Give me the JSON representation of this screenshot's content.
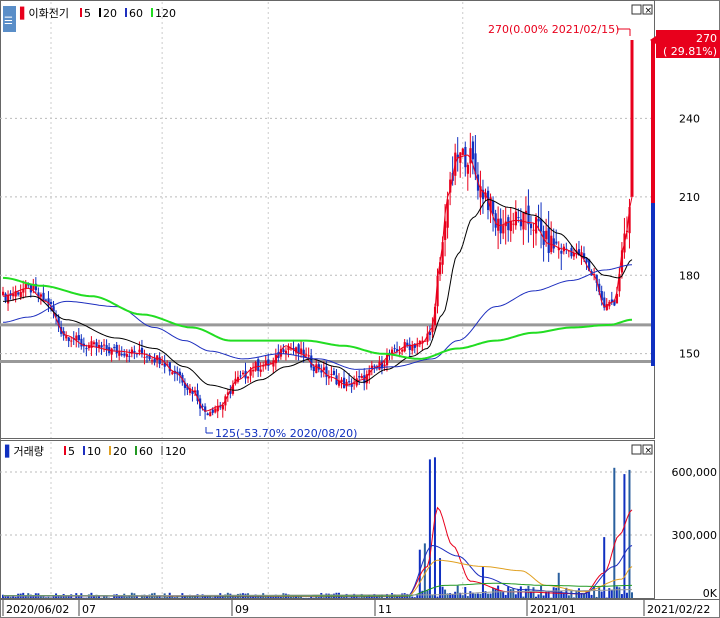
{
  "price_panel": {
    "title": "이화전기",
    "ma_legend": [
      {
        "label": "5",
        "color": "#e8001c"
      },
      {
        "label": "20",
        "color": "#000000"
      },
      {
        "label": "60",
        "color": "#1e2fbf"
      },
      {
        "label": "120",
        "color": "#22dd22"
      }
    ],
    "high_annotation": "270(0.00% 2021/02/15)",
    "low_annotation": "125(-53.70% 2020/08/20)",
    "current_price": "270",
    "current_change": "( 29.81%)"
  },
  "volume_panel": {
    "title": "거래량",
    "ma_legend": [
      {
        "label": "5",
        "color": "#e8001c"
      },
      {
        "label": "10",
        "color": "#1e2fbf"
      },
      {
        "label": "20",
        "color": "#e0a020"
      },
      {
        "label": "60",
        "color": "#229922"
      },
      {
        "label": "120",
        "color": "#999999"
      }
    ]
  },
  "colors": {
    "up": "#e8001c",
    "down": "#1030c0",
    "ma5": "#e8001c",
    "ma20": "#000000",
    "ma60": "#1e2fbf",
    "ma120": "#22dd22",
    "hline": "#999999"
  },
  "chart_data": [
    {
      "type": "candlestick",
      "title": "이화전기",
      "y_ticks": [
        "240",
        "210",
        "180",
        "150"
      ],
      "ylim": [
        118,
        287
      ],
      "x_ticks": [
        "2020/06/02",
        "07",
        "09",
        "11",
        "2021/01",
        "2021/02/22"
      ],
      "x_range": [
        "2020/06/02",
        "2021/02/22"
      ],
      "horizontal_lines": [
        161,
        147
      ],
      "period_high": {
        "value": 270,
        "date": "2021/02/15"
      },
      "period_low": {
        "value": 125,
        "date": "2020/08/20"
      },
      "last_close": 270,
      "last_change_pct": 29.81,
      "grid": true,
      "series": [
        {
          "name": "5",
          "anchors": [
            [
              0,
              172
            ],
            [
              10,
              175
            ],
            [
              17,
              170
            ],
            [
              25,
              157
            ],
            [
              33,
              153
            ],
            [
              45,
              151
            ],
            [
              55,
              150
            ],
            [
              62,
              148
            ],
            [
              68,
              143
            ],
            [
              75,
              136
            ],
            [
              80,
              128
            ],
            [
              86,
              130
            ],
            [
              93,
              140
            ],
            [
              100,
              145
            ],
            [
              106,
              146
            ],
            [
              112,
              153
            ],
            [
              118,
              150
            ],
            [
              124,
              145
            ],
            [
              130,
              141
            ],
            [
              136,
              138
            ],
            [
              142,
              140
            ],
            [
              148,
              145
            ],
            [
              154,
              150
            ],
            [
              160,
              153
            ],
            [
              166,
              154
            ],
            [
              170,
              160
            ],
            [
              173,
              185
            ],
            [
              176,
              210
            ],
            [
              180,
              225
            ],
            [
              184,
              226
            ],
            [
              190,
              212
            ],
            [
              196,
              199
            ],
            [
              203,
              201
            ],
            [
              210,
              200
            ],
            [
              216,
              192
            ],
            [
              222,
              190
            ],
            [
              228,
              188
            ],
            [
              234,
              180
            ],
            [
              238,
              168
            ],
            [
              242,
              170
            ],
            [
              246,
              192
            ],
            [
              249,
              210
            ]
          ]
        },
        {
          "name": "20",
          "anchors": [
            [
              0,
              170
            ],
            [
              12,
              172
            ],
            [
              25,
              163
            ],
            [
              45,
              156
            ],
            [
              60,
              152
            ],
            [
              72,
              145
            ],
            [
              82,
              138
            ],
            [
              92,
              136
            ],
            [
              102,
              140
            ],
            [
              112,
              145
            ],
            [
              122,
              148
            ],
            [
              132,
              145
            ],
            [
              142,
              139
            ],
            [
              152,
              144
            ],
            [
              162,
              149
            ],
            [
              168,
              152
            ],
            [
              174,
              165
            ],
            [
              180,
              188
            ],
            [
              186,
              202
            ],
            [
              192,
              209
            ],
            [
              200,
              206
            ],
            [
              210,
              203
            ],
            [
              220,
              196
            ],
            [
              230,
              187
            ],
            [
              238,
              180
            ],
            [
              244,
              179
            ],
            [
              249,
              186
            ]
          ]
        },
        {
          "name": "60",
          "anchors": [
            [
              0,
              162
            ],
            [
              10,
              164
            ],
            [
              25,
              170
            ],
            [
              45,
              168
            ],
            [
              60,
              160
            ],
            [
              72,
              155
            ],
            [
              82,
              151
            ],
            [
              95,
              148
            ],
            [
              110,
              150
            ],
            [
              125,
              148
            ],
            [
              140,
              144
            ],
            [
              155,
              145
            ],
            [
              170,
              148
            ],
            [
              180,
              155
            ],
            [
              195,
              168
            ],
            [
              210,
              174
            ],
            [
              225,
              178
            ],
            [
              238,
              182
            ],
            [
              249,
              184
            ]
          ]
        },
        {
          "name": "120",
          "anchors": [
            [
              0,
              179
            ],
            [
              15,
              176
            ],
            [
              35,
              172
            ],
            [
              55,
              165
            ],
            [
              75,
              160
            ],
            [
              90,
              155
            ],
            [
              105,
              155
            ],
            [
              120,
              155
            ],
            [
              135,
              153
            ],
            [
              150,
              150
            ],
            [
              165,
              148
            ],
            [
              180,
              152
            ],
            [
              195,
              155
            ],
            [
              210,
              158
            ],
            [
              225,
              160
            ],
            [
              240,
              161
            ],
            [
              249,
              163
            ]
          ]
        }
      ]
    },
    {
      "type": "bar",
      "title": "거래량",
      "y_ticks": [
        "600,000",
        "300,000",
        "0K"
      ],
      "ylim": [
        0,
        700000
      ],
      "spikes": [
        [
          165,
          230000
        ],
        [
          167,
          260000
        ],
        [
          169,
          660000
        ],
        [
          171,
          670000
        ],
        [
          173,
          190000
        ],
        [
          175,
          40000
        ],
        [
          190,
          150000
        ],
        [
          220,
          120000
        ],
        [
          238,
          290000
        ],
        [
          242,
          620000
        ],
        [
          246,
          590000
        ],
        [
          248,
          610000
        ]
      ],
      "series": [
        {
          "name": "5",
          "anchors": [
            [
              0,
              10000
            ],
            [
              160,
              8000
            ],
            [
              168,
              150000
            ],
            [
              172,
              430000
            ],
            [
              178,
              250000
            ],
            [
              185,
              80000
            ],
            [
              200,
              30000
            ],
            [
              230,
              20000
            ],
            [
              238,
              120000
            ],
            [
              244,
              300000
            ],
            [
              249,
              420000
            ]
          ]
        },
        {
          "name": "10",
          "anchors": [
            [
              0,
              9000
            ],
            [
              160,
              8000
            ],
            [
              170,
              250000
            ],
            [
              180,
              200000
            ],
            [
              190,
              100000
            ],
            [
              205,
              40000
            ],
            [
              230,
              20000
            ],
            [
              242,
              150000
            ],
            [
              249,
              250000
            ]
          ]
        },
        {
          "name": "20",
          "anchors": [
            [
              0,
              10000
            ],
            [
              160,
              9000
            ],
            [
              172,
              180000
            ],
            [
              190,
              150000
            ],
            [
              205,
              130000
            ],
            [
              215,
              60000
            ],
            [
              230,
              30000
            ],
            [
              245,
              90000
            ],
            [
              249,
              150000
            ]
          ]
        },
        {
          "name": "60",
          "anchors": [
            [
              0,
              12000
            ],
            [
              160,
              10000
            ],
            [
              175,
              60000
            ],
            [
              195,
              70000
            ],
            [
              215,
              60000
            ],
            [
              235,
              55000
            ],
            [
              249,
              60000
            ]
          ]
        },
        {
          "name": "120",
          "anchors": [
            [
              0,
              10000
            ],
            [
              170,
              15000
            ],
            [
              200,
              30000
            ],
            [
              230,
              35000
            ],
            [
              249,
              40000
            ]
          ]
        }
      ]
    }
  ]
}
